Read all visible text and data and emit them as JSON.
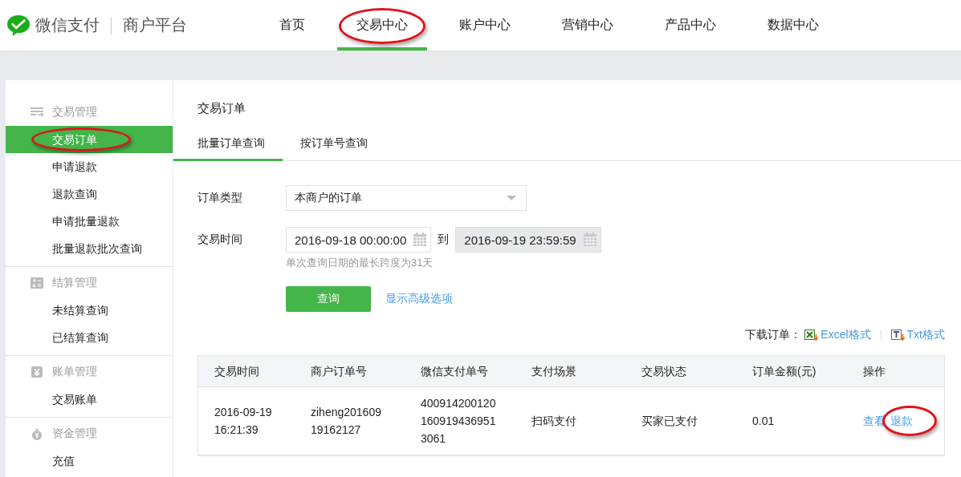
{
  "brand": {
    "name": "微信支付",
    "subtitle": "商户平台"
  },
  "nav": [
    {
      "label": "首页",
      "selected": false,
      "circled": false
    },
    {
      "label": "交易中心",
      "selected": true,
      "circled": true
    },
    {
      "label": "账户中心",
      "selected": false,
      "circled": false
    },
    {
      "label": "营销中心",
      "selected": false,
      "circled": false
    },
    {
      "label": "产品中心",
      "selected": false,
      "circled": false
    },
    {
      "label": "数据中心",
      "selected": false,
      "circled": false
    }
  ],
  "sidebar": {
    "groups": [
      {
        "title": "交易管理",
        "items": [
          {
            "label": "交易订单",
            "selected": true,
            "circled": true
          },
          {
            "label": "申请退款",
            "selected": false,
            "circled": false
          },
          {
            "label": "退款查询",
            "selected": false,
            "circled": false
          },
          {
            "label": "申请批量退款",
            "selected": false,
            "circled": false
          },
          {
            "label": "批量退款批次查询",
            "selected": false,
            "circled": false
          }
        ]
      },
      {
        "title": "结算管理",
        "items": [
          {
            "label": "未结算查询",
            "selected": false,
            "circled": false
          },
          {
            "label": "已结算查询",
            "selected": false,
            "circled": false
          }
        ]
      },
      {
        "title": "账单管理",
        "items": [
          {
            "label": "交易账单",
            "selected": false,
            "circled": false
          }
        ]
      },
      {
        "title": "资金管理",
        "items": [
          {
            "label": "充值",
            "selected": false,
            "circled": false
          }
        ]
      }
    ]
  },
  "page_title": "交易订单",
  "tabs": [
    {
      "label": "批量订单查询",
      "selected": true
    },
    {
      "label": "按订单号查询",
      "selected": false
    }
  ],
  "form": {
    "order_type": {
      "label": "订单类型",
      "value": "本商户的订单"
    },
    "time": {
      "label": "交易时间",
      "start": "2016-09-18 00:00:00",
      "separator": "到",
      "end": "2016-09-19 23:59:59",
      "end_disabled": true,
      "hint": "单次查询日期的最长跨度为31天"
    },
    "submit": "查询",
    "advanced_link": "显示高级选项"
  },
  "download": {
    "label": "下载订单：",
    "links": [
      {
        "kind": "excel",
        "label": "Excel格式"
      },
      {
        "kind": "txt",
        "label": "Txt格式"
      }
    ]
  },
  "table": {
    "columns": [
      "交易时间",
      "商户订单号",
      "微信支付单号",
      "支付场景",
      "交易状态",
      "订单金额(元)",
      "操作"
    ],
    "rows": [
      {
        "cells": [
          "2016-09-19\n16:21:39",
          "ziheng201609\n19162127",
          "400914200120\n160919436951\n3061",
          "扫码支付",
          "买家已支付",
          "0.01"
        ],
        "actions": [
          {
            "label": "查看",
            "circled": false
          },
          {
            "label": "退款",
            "circled": true
          }
        ]
      }
    ]
  }
}
